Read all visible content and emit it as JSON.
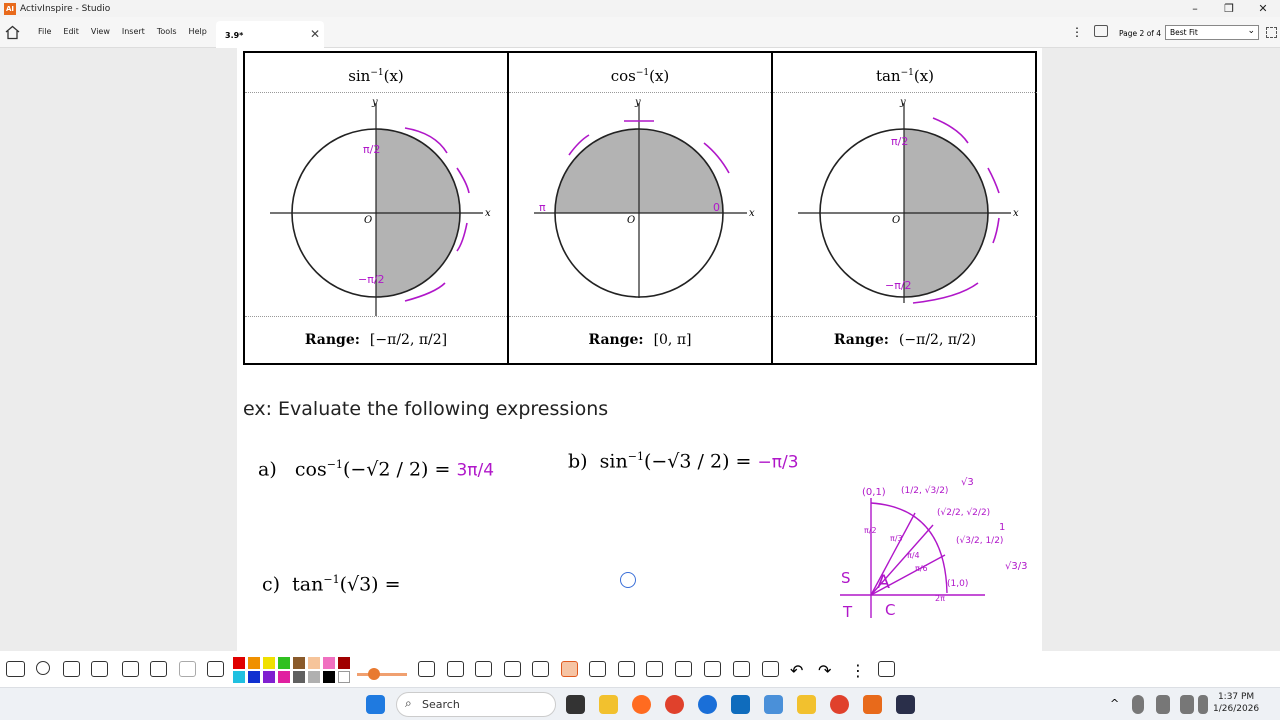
{
  "window": {
    "title": "ActivInspire - Studio",
    "controls": [
      "–",
      "❐",
      "✕"
    ]
  },
  "menu": {
    "items": [
      "File",
      "Edit",
      "View",
      "Insert",
      "Tools",
      "Help"
    ]
  },
  "tab": {
    "label": "3.9*",
    "close": "✕"
  },
  "header": {
    "page_info": "Page 2 of 4",
    "zoom": "Best Fit"
  },
  "table": {
    "columns": [
      {
        "func": "sin",
        "sup": "−1",
        "arg": "(x)",
        "range_label": "Range:",
        "range": "[−π/2, π/2]"
      },
      {
        "func": "cos",
        "sup": "−1",
        "arg": "(x)",
        "range_label": "Range:",
        "range": "[0, π]"
      },
      {
        "func": "tan",
        "sup": "−1",
        "arg": "(x)",
        "range_label": "Range:",
        "range": "(−π/2, π/2)"
      }
    ],
    "axis_x": "x",
    "axis_y": "y",
    "origin": "O"
  },
  "example": {
    "title": "ex: Evaluate the following expressions",
    "a": {
      "label": "a)",
      "func": "cos",
      "sup": "−1",
      "arg": "(−√2 / 2) =",
      "answer": "3π/4"
    },
    "b": {
      "label": "b)",
      "func": "sin",
      "sup": "−1",
      "arg": "(−√3 / 2) =",
      "answer": "−π/3"
    },
    "c": {
      "label": "c)",
      "func": "tan",
      "sup": "−1",
      "arg": "(√3) ="
    }
  },
  "annotations": {
    "quadrants": [
      "S",
      "A",
      "T",
      "C"
    ],
    "points": [
      "(0,1)",
      "(1/2, √3/2)",
      "(√2/2, √2/2)",
      "(√3/2, 1/2)",
      "(1,0)"
    ],
    "slopes": [
      "√3",
      "1",
      "√3/3"
    ],
    "angles": [
      "π/2",
      "π/3",
      "π/4",
      "π/6",
      "2π"
    ],
    "arc_labels": [
      "π/2",
      "−π/2",
      "π",
      "0",
      "π/2",
      "−π/2"
    ]
  },
  "taskbar": {
    "search": "Search",
    "time": "1:37 PM",
    "date": "1/26/2026"
  },
  "colors": {
    "ink": "#b017c9",
    "shade": "#b3b3b3"
  }
}
